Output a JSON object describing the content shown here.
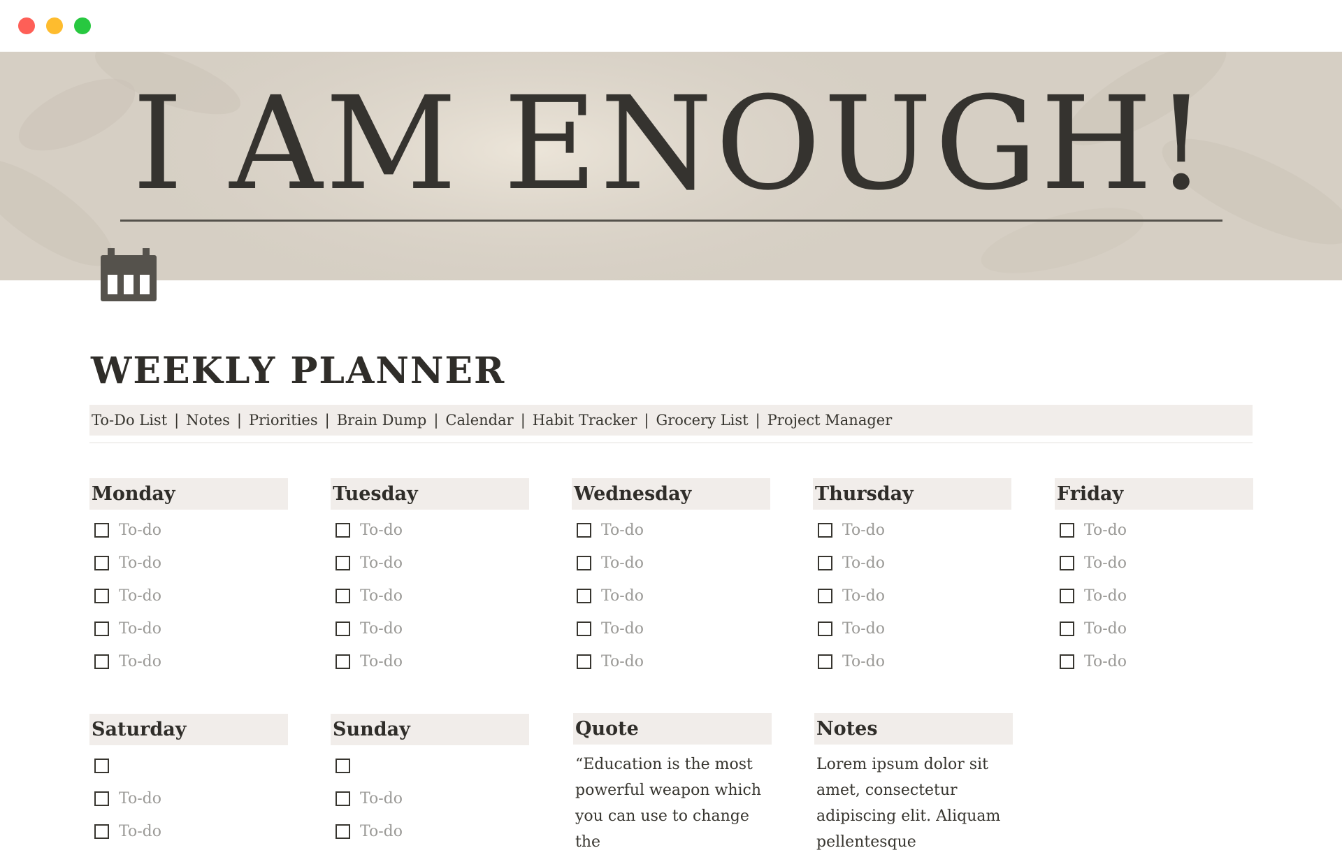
{
  "window": {
    "controls": [
      "close",
      "minimize",
      "zoom"
    ]
  },
  "cover": {
    "title": "I AM ENOUGH!"
  },
  "page": {
    "icon": "calendar-icon",
    "title": "WEEKLY PLANNER"
  },
  "nav": {
    "items": [
      "To-Do List",
      "Notes",
      "Priorities",
      "Brain Dump",
      "Calendar",
      "Habit Tracker",
      "Grocery List",
      "Project Manager"
    ],
    "separator": "|"
  },
  "days": [
    {
      "name": "Monday",
      "todos": [
        "To-do",
        "To-do",
        "To-do",
        "To-do",
        "To-do"
      ]
    },
    {
      "name": "Tuesday",
      "todos": [
        "To-do",
        "To-do",
        "To-do",
        "To-do",
        "To-do"
      ]
    },
    {
      "name": "Wednesday",
      "todos": [
        "To-do",
        "To-do",
        "To-do",
        "To-do",
        "To-do"
      ]
    },
    {
      "name": "Thursday",
      "todos": [
        "To-do",
        "To-do",
        "To-do",
        "To-do",
        "To-do"
      ]
    },
    {
      "name": "Friday",
      "todos": [
        "To-do",
        "To-do",
        "To-do",
        "To-do",
        "To-do"
      ]
    },
    {
      "name": "Saturday",
      "todos": [
        "",
        "To-do",
        "To-do"
      ]
    },
    {
      "name": "Sunday",
      "todos": [
        "",
        "To-do",
        "To-do"
      ]
    }
  ],
  "quote": {
    "heading": "Quote",
    "text": "“Education is the most powerful weapon which you can use to change the"
  },
  "notes": {
    "heading": "Notes",
    "text": "Lorem ipsum dolor sit amet, consectetur adipiscing elit. Aliquam pellentesque"
  },
  "colors": {
    "cover_bg": "#d6cfc4",
    "block_bg": "#f1edea",
    "text": "#37352f",
    "placeholder": "#9b9a97"
  }
}
